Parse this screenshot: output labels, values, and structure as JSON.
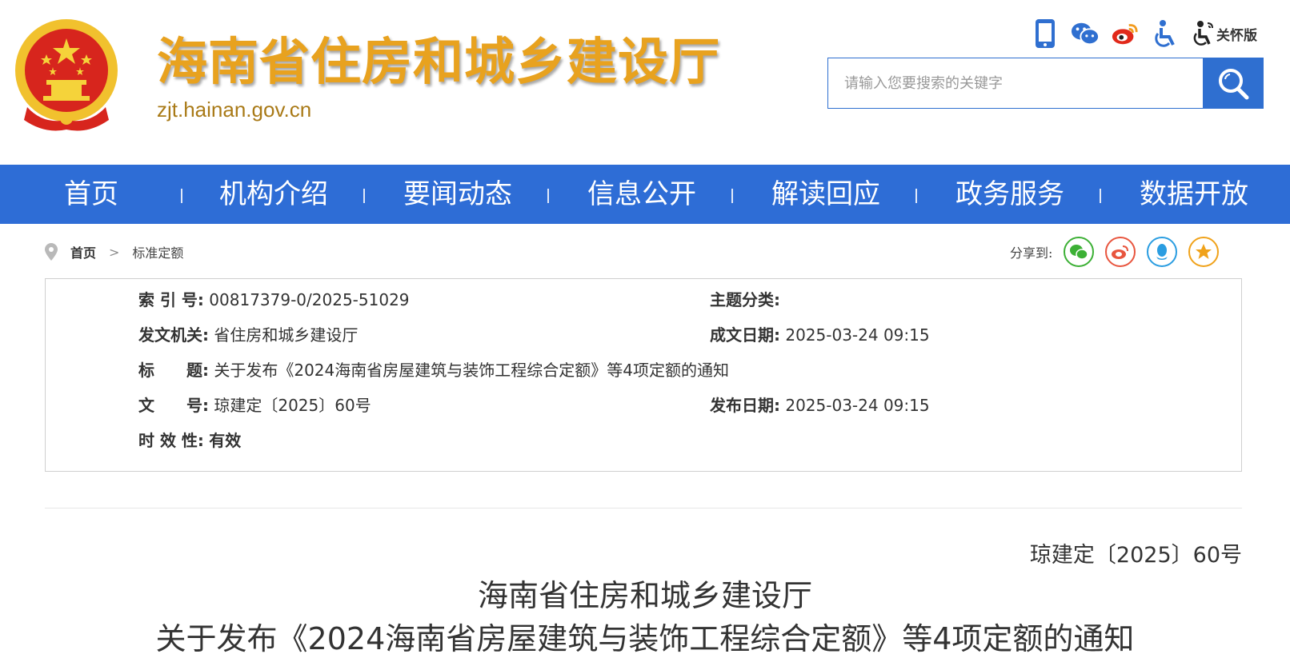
{
  "header": {
    "site_title": "海南省住房和城乡建设厅",
    "site_domain": "zjt.hainan.gov.cn",
    "care_label": "关怀版",
    "icons": [
      "mobile-icon",
      "wechat-icon",
      "weibo-icon",
      "accessibility-icon",
      "elder-care-icon"
    ],
    "search_placeholder": "请输入您要搜索的关键字"
  },
  "nav": {
    "items": [
      "首页",
      "机构介绍",
      "要闻动态",
      "信息公开",
      "解读回应",
      "政务服务",
      "数据开放"
    ]
  },
  "breadcrumb": {
    "home": "首页",
    "separator": ">",
    "current": "标准定额"
  },
  "share": {
    "label": "分享到:"
  },
  "info": {
    "index_label": "索 引 号:",
    "index_value": "00817379-0/2025-51029",
    "subject_label": "主题分类:",
    "subject_value": "",
    "issuer_label": "发文机关:",
    "issuer_value": "省住房和城乡建设厅",
    "created_label": "成文日期:",
    "created_value": "2025-03-24 09:15",
    "title_label": "标　　题:",
    "title_value": "关于发布《2024海南省房屋建筑与装饰工程综合定额》等4项定额的通知",
    "docno_label": "文　　号:",
    "docno_value": "琼建定〔2025〕60号",
    "published_label": "发布日期:",
    "published_value": "2025-03-24 09:15",
    "validity_label": "时 效 性:",
    "validity_value": "有效"
  },
  "document": {
    "number": "琼建定〔2025〕60号",
    "title_line1": "海南省住房和城乡建设厅",
    "title_line2": "关于发布《2024海南省房屋建筑与装饰工程综合定额》等4项定额的通知"
  },
  "colors": {
    "nav_bg": "#2e6dd6",
    "title_gold": "#e8a21f",
    "emblem_red": "#d7251d"
  }
}
